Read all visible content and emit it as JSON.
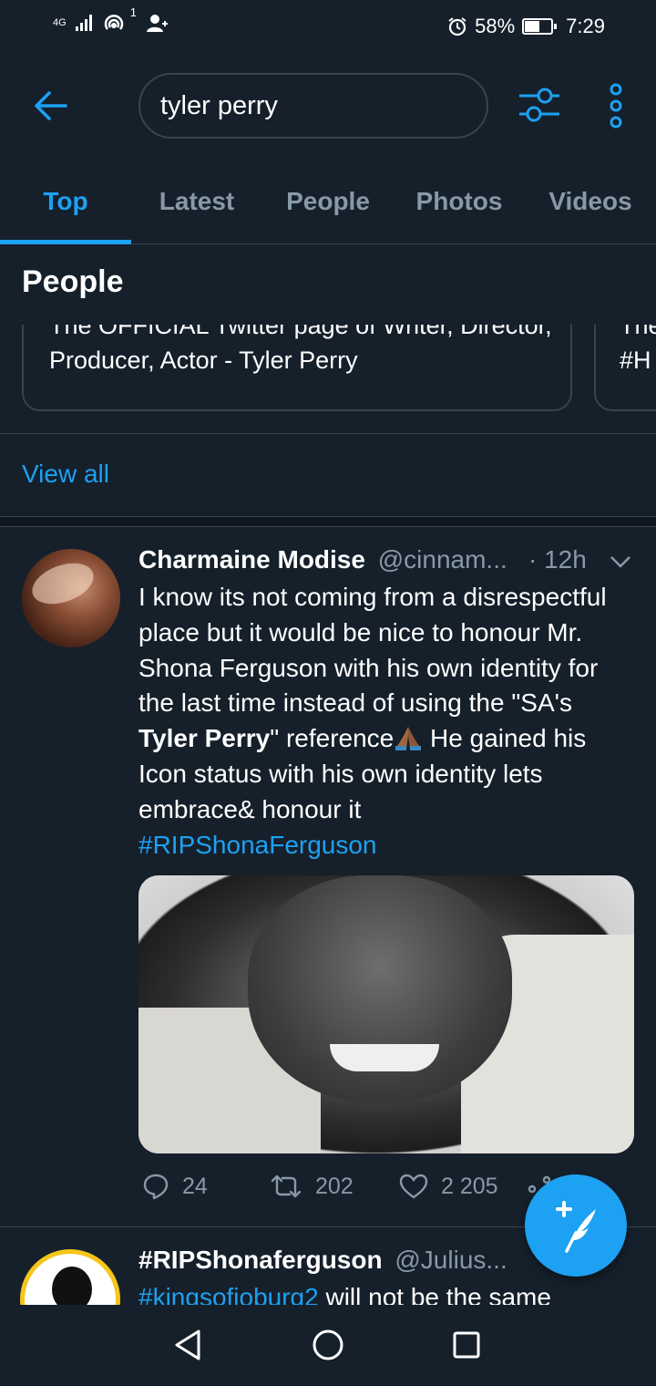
{
  "status_bar": {
    "network": "4G",
    "notification_count": "1",
    "battery": "58%",
    "battery_level": 0.58,
    "time": "7:29"
  },
  "search": {
    "query": "tyler perry"
  },
  "tabs": [
    {
      "label": "Top",
      "active": true
    },
    {
      "label": "Latest",
      "active": false
    },
    {
      "label": "People",
      "active": false
    },
    {
      "label": "Photos",
      "active": false
    },
    {
      "label": "Videos",
      "active": false
    }
  ],
  "people_section": {
    "title": "People",
    "cards": [
      {
        "bio": "The OFFICIAL Twitter page of Writer, Director, Producer, Actor - Tyler Perry"
      },
      {
        "bio": "The\n#H"
      }
    ],
    "view_all": "View all"
  },
  "tweet": {
    "name": "Charmaine Modise",
    "handle": "@cinnam...",
    "time": "· 12h",
    "text_1": "I know its not coming from a disrespectful place but it would be nice to honour Mr. Shona Ferguson with his own identity for the last time instead of using the \"SA's ",
    "text_bold": "Tyler Perry",
    "text_2": "\" reference",
    "text_3": " He gained his Icon status with his own identity lets embrace& honour it",
    "hashtag": "#RIPShonaFerguson",
    "replies": "24",
    "retweets": "202",
    "likes": "2 205"
  },
  "tweet2": {
    "name": "#RIPShonaferguson",
    "handle": "@Julius...",
    "hashtag": "#kingsofjoburg2",
    "text": " will not be the same"
  },
  "colors": {
    "background": "#15202b",
    "accent": "#1da1f2",
    "muted": "#8899a6",
    "border": "#38444d"
  },
  "icons": {
    "back": "arrow-left-icon",
    "filter": "sliders-icon",
    "more": "vertical-dots-icon",
    "compose": "compose-feather-icon"
  }
}
